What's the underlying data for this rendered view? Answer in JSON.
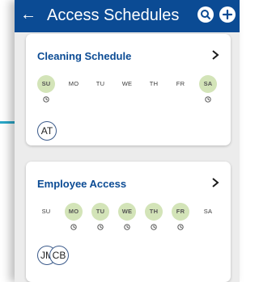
{
  "header": {
    "title": "Access Schedules",
    "back_icon": "arrow-left-icon",
    "search_icon": "search-icon",
    "add_icon": "plus-icon"
  },
  "colors": {
    "primary": "#0b4b94",
    "active_day": "#d3e4b8",
    "card_title": "#0b4b94"
  },
  "schedules": [
    {
      "name": "Cleaning Schedule",
      "days": [
        {
          "label": "SU",
          "active": true
        },
        {
          "label": "MO",
          "active": false
        },
        {
          "label": "TU",
          "active": false
        },
        {
          "label": "WE",
          "active": false
        },
        {
          "label": "TH",
          "active": false
        },
        {
          "label": "FR",
          "active": false
        },
        {
          "label": "SA",
          "active": true
        }
      ],
      "members": [
        "AT"
      ]
    },
    {
      "name": "Employee Access",
      "days": [
        {
          "label": "SU",
          "active": false
        },
        {
          "label": "MO",
          "active": true
        },
        {
          "label": "TU",
          "active": true
        },
        {
          "label": "WE",
          "active": true
        },
        {
          "label": "TH",
          "active": true
        },
        {
          "label": "FR",
          "active": true
        },
        {
          "label": "SA",
          "active": false
        }
      ],
      "members": [
        "JM",
        "CB"
      ]
    }
  ]
}
